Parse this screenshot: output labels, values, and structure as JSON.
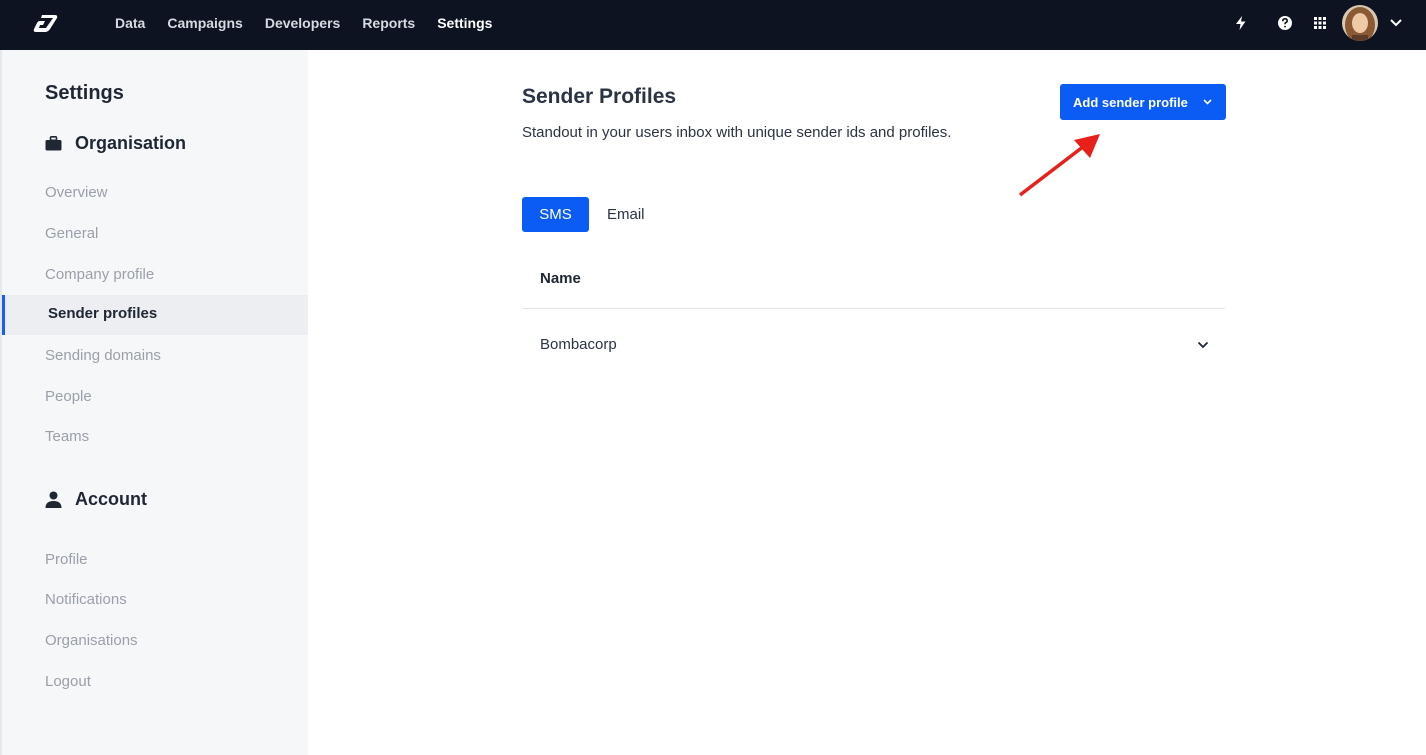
{
  "topnav": {
    "items": [
      {
        "label": "Data"
      },
      {
        "label": "Campaigns"
      },
      {
        "label": "Developers"
      },
      {
        "label": "Reports"
      },
      {
        "label": "Settings"
      }
    ],
    "active": "Settings",
    "icons": [
      "lightning-icon",
      "help-icon",
      "apps-grid-icon",
      "avatar",
      "chevron-down-icon"
    ]
  },
  "sidebar": {
    "title": "Settings",
    "organisation": {
      "label": "Organisation",
      "icon": "briefcase-icon",
      "items": [
        {
          "label": "Overview"
        },
        {
          "label": "General"
        },
        {
          "label": "Company profile"
        },
        {
          "label": "Sender profiles"
        },
        {
          "label": "Sending domains"
        },
        {
          "label": "People"
        },
        {
          "label": "Teams"
        }
      ],
      "active": "Sender profiles"
    },
    "account": {
      "label": "Account",
      "icon": "person-icon",
      "items": [
        {
          "label": "Profile"
        },
        {
          "label": "Notifications"
        },
        {
          "label": "Organisations"
        },
        {
          "label": "Logout"
        }
      ]
    }
  },
  "main": {
    "title": "Sender Profiles",
    "subtitle": "Standout in your users inbox with unique sender ids and profiles.",
    "add_button": "Add sender profile",
    "tabs": [
      {
        "label": "SMS",
        "active": true
      },
      {
        "label": "Email",
        "active": false
      }
    ],
    "table": {
      "columns": [
        "Name"
      ],
      "rows": [
        {
          "name": "Bombacorp"
        }
      ]
    }
  },
  "colors": {
    "topbar": "#0d1321",
    "accent": "#0a5cf5",
    "annotation_arrow": "#e8201c"
  }
}
